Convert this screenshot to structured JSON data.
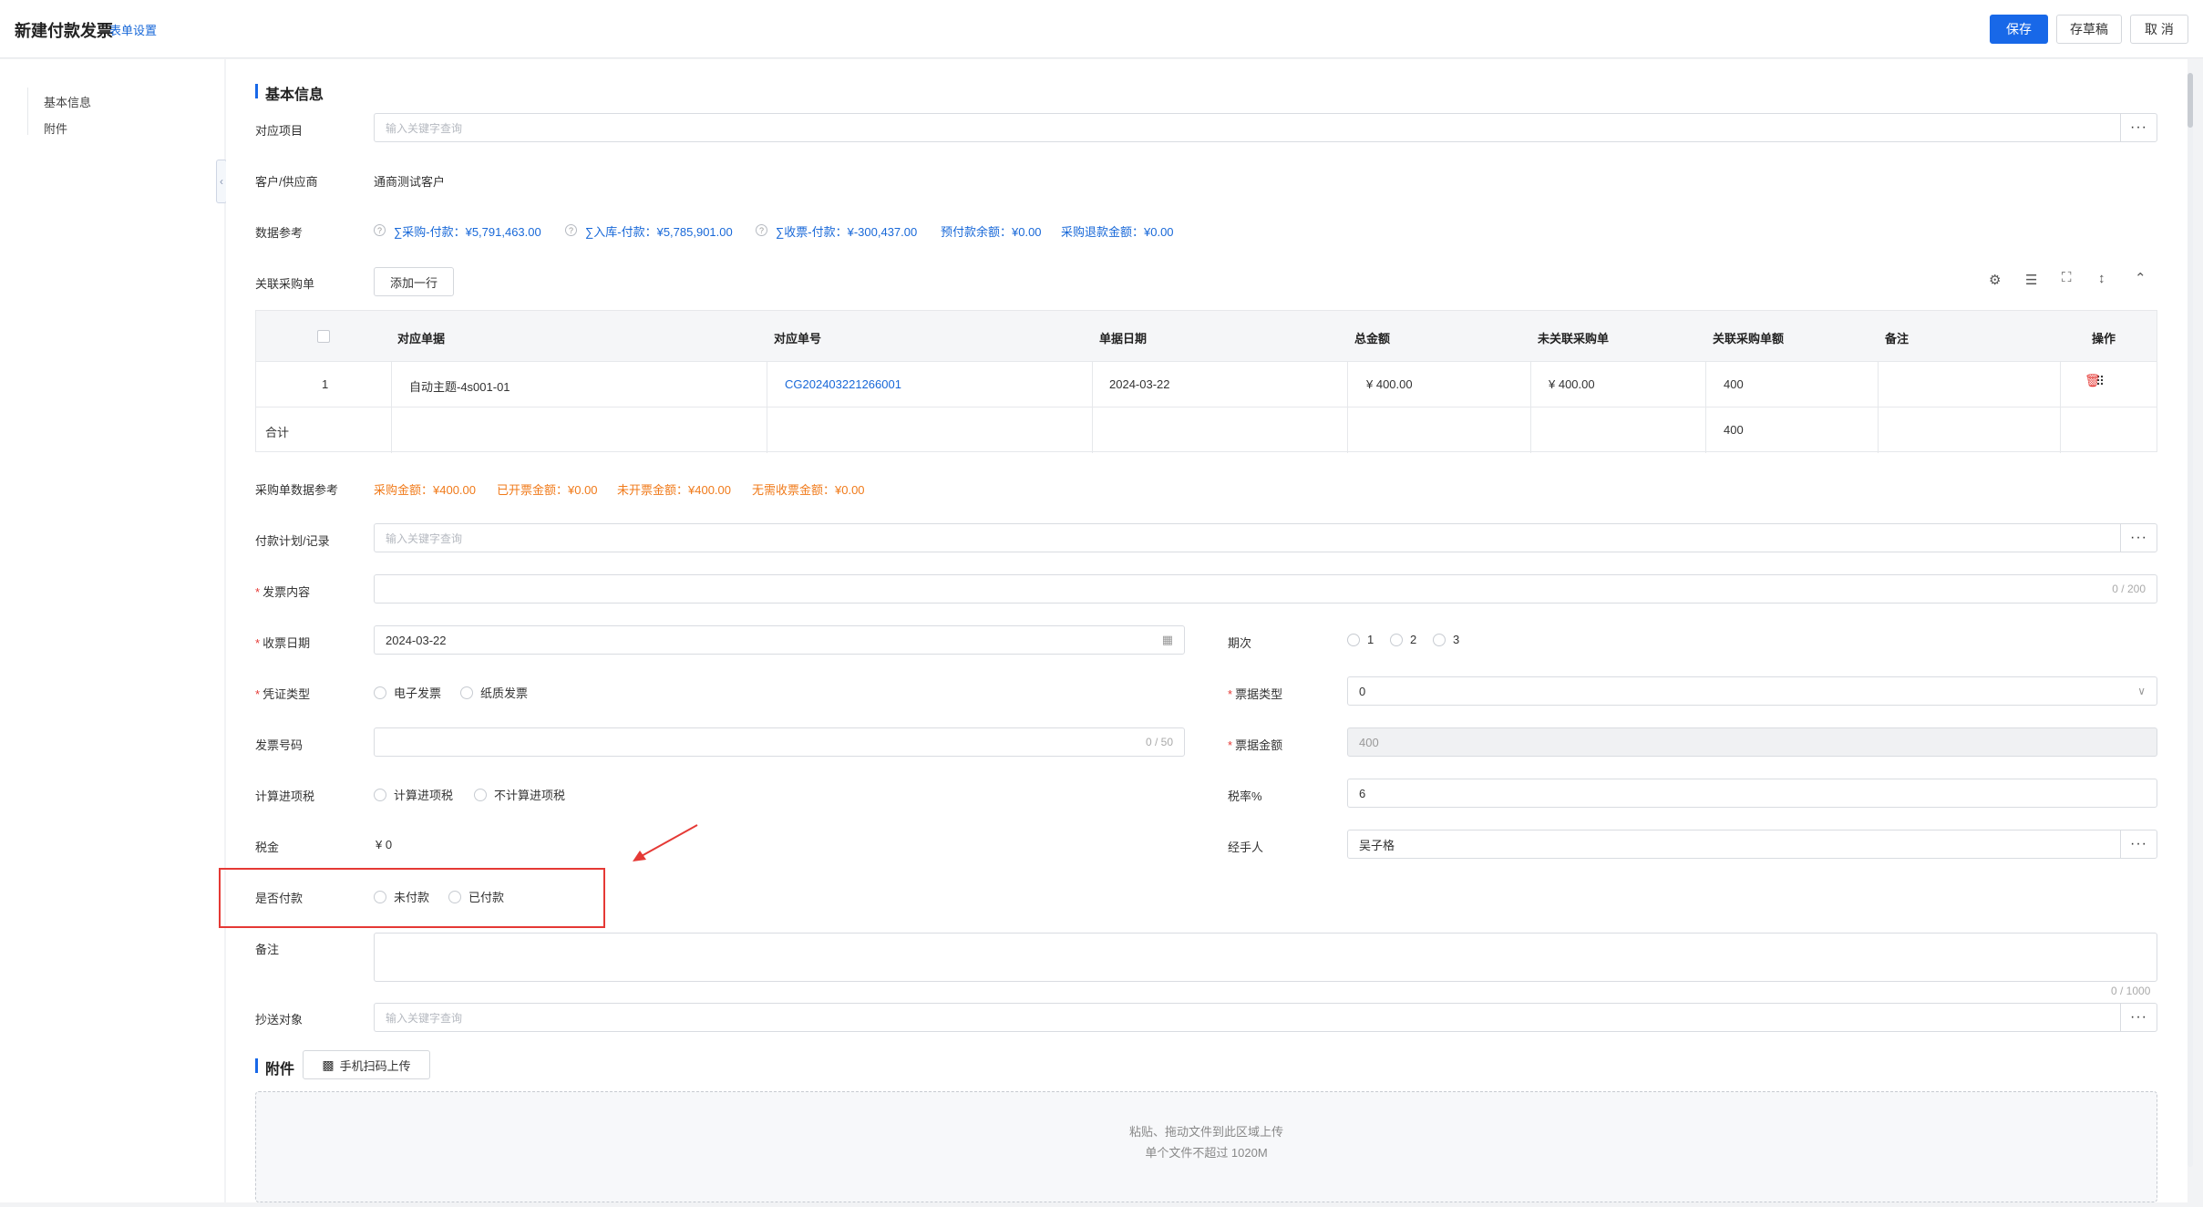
{
  "header": {
    "title": "新建付款发票",
    "form_settings": "表单设置",
    "save": "保存",
    "draft": "存草稿",
    "cancel": "取 消"
  },
  "leftnav": {
    "items": [
      "基本信息",
      "附件"
    ]
  },
  "basic": {
    "section_title": "基本信息",
    "project_label": "对应项目",
    "project_placeholder": "输入关键字查询",
    "customer_label": "客户/供应商",
    "customer_value": "通商测试客户",
    "data_ref_label": "数据参考",
    "data_refs": [
      "∑采购-付款：¥5,791,463.00",
      "∑入库-付款：¥5,785,901.00",
      "∑收票-付款：¥-300,437.00",
      "预付款余额：¥0.00",
      "采购退款金额：¥0.00"
    ],
    "linked_po_label": "关联采购单",
    "add_row": "添加一行"
  },
  "table": {
    "headers": [
      "对应单据",
      "对应单号",
      "单据日期",
      "总金额",
      "未关联采购单",
      "关联采购单额",
      "备注",
      "操作"
    ],
    "row": {
      "index": "1",
      "doc": "自动主题-4s001-01",
      "doc_no": "CG202403221266001",
      "date": "2024-03-22",
      "total": "¥ 400.00",
      "unlinked": "¥ 400.00",
      "linked": "400",
      "remark": ""
    },
    "sum_label": "合计",
    "sum_linked": "400"
  },
  "po_ref": {
    "label": "采购单数据参考",
    "items": [
      "采购金额：¥400.00",
      "已开票金额：¥0.00",
      "未开票金额：¥400.00",
      "无需收票金额：¥0.00"
    ]
  },
  "form": {
    "payplan_label": "付款计划/记录",
    "payplan_placeholder": "输入关键字查询",
    "invoice_content_label": "发票内容",
    "invoice_content_counter": "0 / 200",
    "receive_date_label": "收票日期",
    "receive_date_value": "2024-03-22",
    "period_label": "期次",
    "period_options": [
      "1",
      "2",
      "3"
    ],
    "voucher_type_label": "凭证类型",
    "voucher_options": [
      "电子发票",
      "纸质发票"
    ],
    "bill_type_label": "票据类型",
    "bill_type_value": "0",
    "invoice_no_label": "发票号码",
    "invoice_no_counter": "0 / 50",
    "bill_amount_label": "票据金额",
    "bill_amount_value": "400",
    "tax_calc_label": "计算进项税",
    "tax_calc_options": [
      "计算进项税",
      "不计算进项税"
    ],
    "tax_rate_label": "税率%",
    "tax_rate_value": "6",
    "tax_label": "税金",
    "tax_value": "¥  0",
    "handler_label": "经手人",
    "handler_value": "吴子格",
    "paid_label": "是否付款",
    "paid_options": [
      "未付款",
      "已付款"
    ],
    "remark_label": "备注",
    "remark_counter": "0 / 1000",
    "cc_label": "抄送对象",
    "cc_placeholder": "输入关键字查询"
  },
  "attachment": {
    "section_title": "附件",
    "scan_upload": "手机扫码上传",
    "hint1": "粘贴、拖动文件到此区域上传",
    "hint2": "单个文件不超过 1020M"
  },
  "colors": {
    "primary": "#1868e8",
    "link": "#1868d8",
    "orange": "#f07a1a",
    "required": "#e53935"
  }
}
